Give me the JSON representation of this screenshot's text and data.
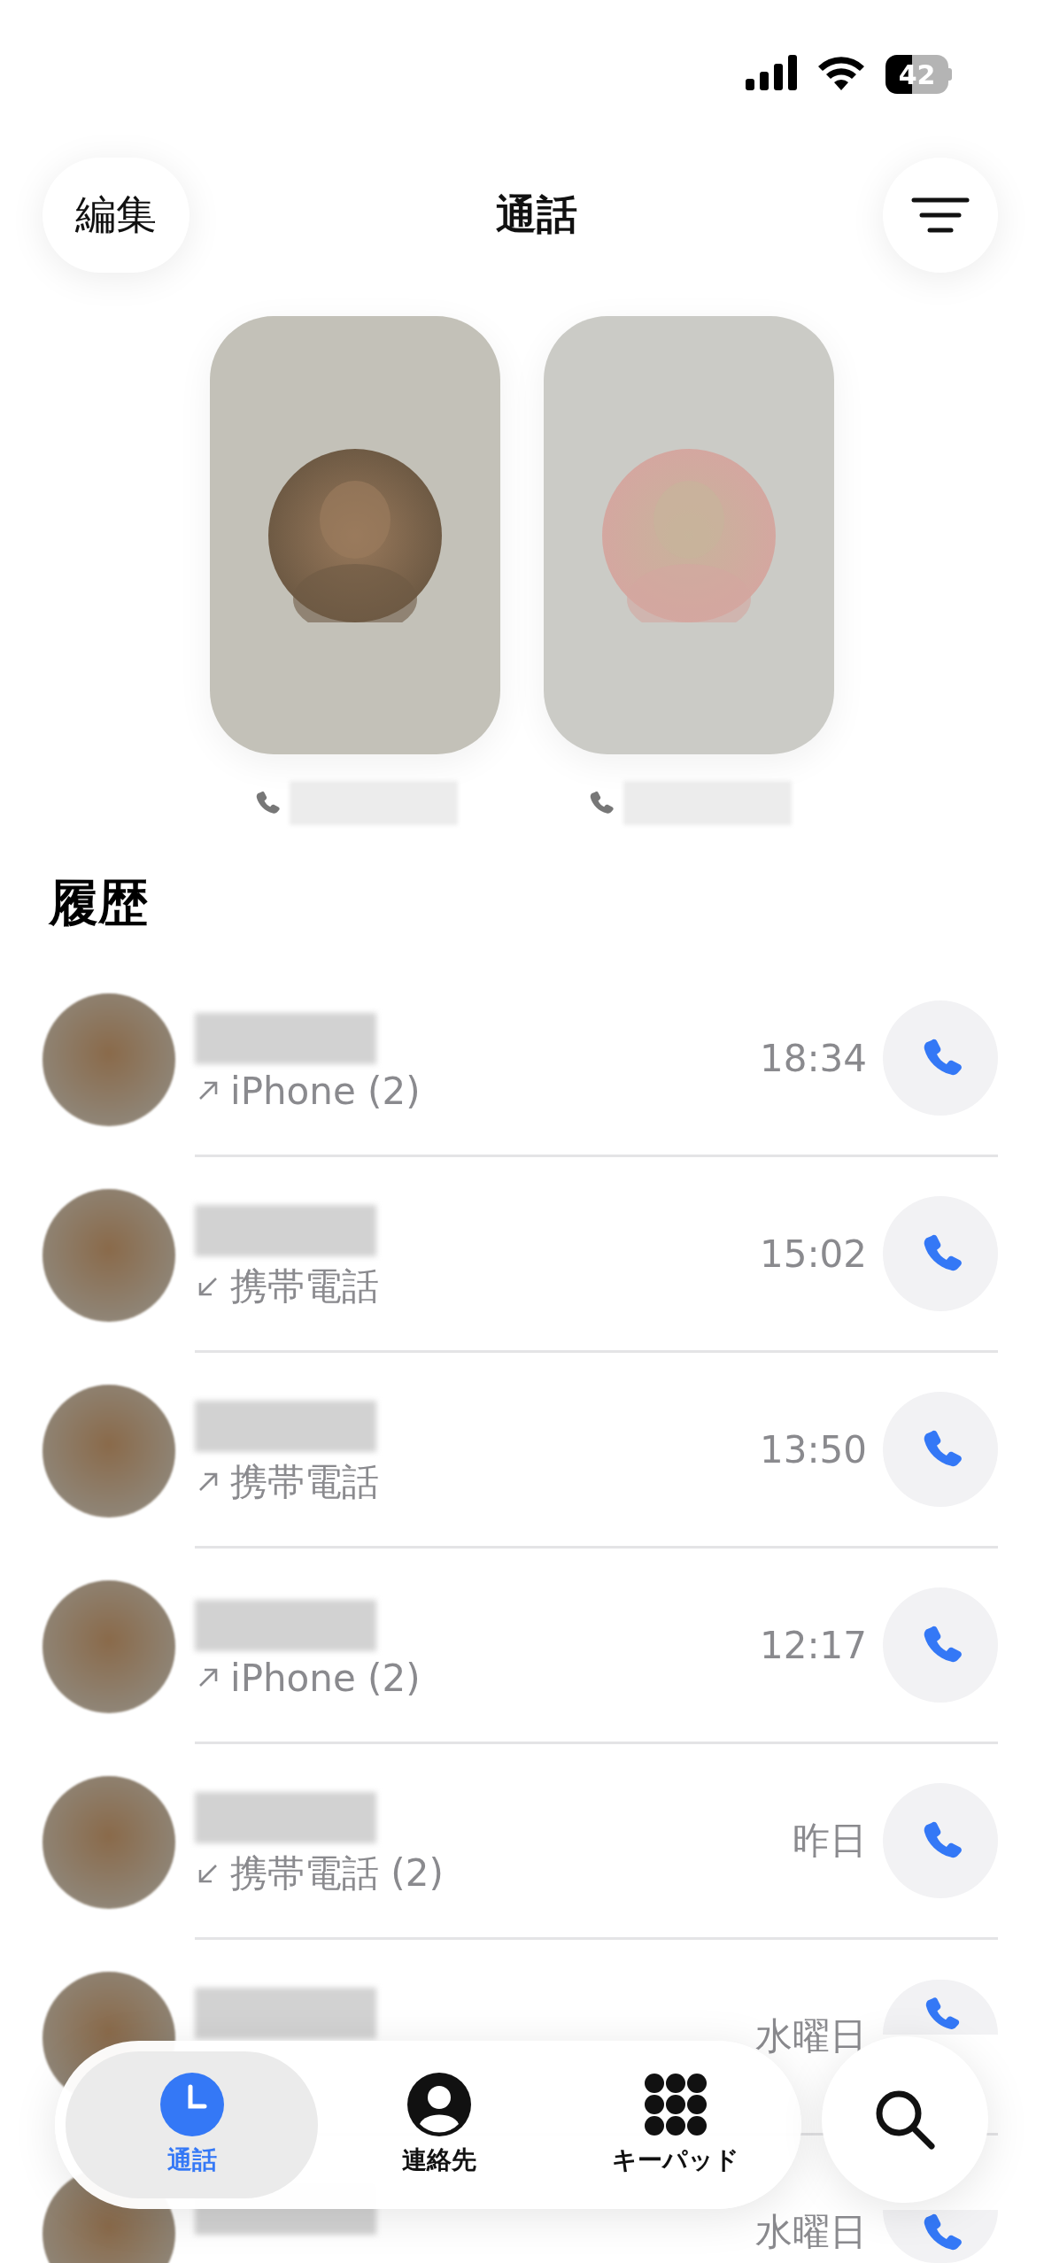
{
  "status_bar": {
    "battery": "42"
  },
  "header": {
    "edit_button": "編集",
    "title": "通話"
  },
  "recents": {
    "title": "履歴",
    "rows": [
      {
        "kind": "outgoing",
        "subtitle": "iPhone (2)",
        "time": "18:34"
      },
      {
        "kind": "incoming",
        "subtitle": "携帯電話",
        "time": "15:02"
      },
      {
        "kind": "outgoing",
        "subtitle": "携帯電話",
        "time": "13:50"
      },
      {
        "kind": "outgoing",
        "subtitle": "iPhone (2)",
        "time": "12:17"
      },
      {
        "kind": "incoming",
        "subtitle": "携帯電話 (2)",
        "time": "昨日"
      },
      {
        "time": "水曜日"
      },
      {
        "time": "水曜日"
      }
    ]
  },
  "tab_bar": {
    "tabs": [
      {
        "kind": "clock",
        "label": "通話",
        "selected": true
      },
      {
        "kind": "person",
        "label": "連絡先",
        "selected": false
      },
      {
        "kind": "keypad",
        "label": "キーパッド",
        "selected": false
      }
    ]
  }
}
